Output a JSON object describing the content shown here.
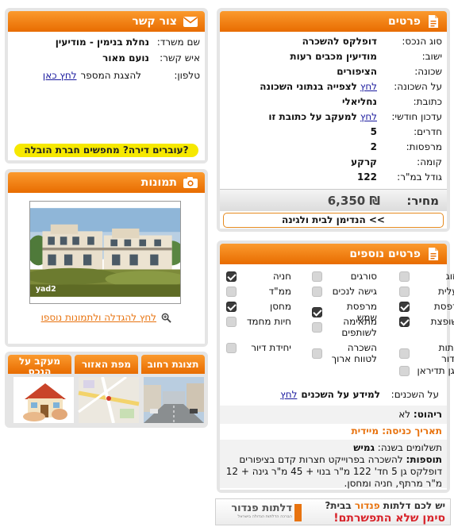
{
  "details": {
    "title": "פרטים",
    "rows": [
      {
        "label": "סוג הנכס:",
        "value": "דופלקס להשכרה"
      },
      {
        "label": "ישוב:",
        "value": "מודיעין מכבים רעות"
      },
      {
        "label": "שכונה:",
        "value": "הציפורים"
      },
      {
        "label": "על השכונה:",
        "value": "לצפייה בנתוני השכונה",
        "link": "לחץ"
      },
      {
        "label": "כתובת:",
        "value": "נחליאלי"
      },
      {
        "label": "עדכון חודשי:",
        "value": "למעקב על כתובת זו",
        "link": "לחץ"
      },
      {
        "label": "חדרים:",
        "value": "5"
      },
      {
        "label": "מרפסות:",
        "value": "2"
      },
      {
        "label": "קומה:",
        "value": "קרקע"
      },
      {
        "label": "גודל במ\"ר:",
        "value": "122"
      }
    ],
    "price_label": "מחיר:",
    "price_value": "₪ 6,350",
    "price_button": "הנדימן לבית ולגינה <<"
  },
  "contact": {
    "title": "צור קשר",
    "rows": [
      {
        "label": "שם משרד:",
        "value": "נחלת בנימין - מודיעין"
      },
      {
        "label": "איש קשר:",
        "value": "נועם מאור"
      }
    ],
    "phone_label": "טלפון:",
    "phone_text": "להצגת המספר",
    "phone_link": "לחץ כאן",
    "moving_banner": "עוברים דירה? מחפשים חברת הובלה?"
  },
  "photos": {
    "title": "תמונות",
    "watermark": "yad2",
    "enlarge_link": "לחץ להגדלה ולתמונות נוספו"
  },
  "tabs": [
    {
      "label": "תצוגת רחוב"
    },
    {
      "label": "מפת האזור"
    },
    {
      "label": "מעקב על הנכס"
    }
  ],
  "extras": {
    "title": "פרטים נוספים",
    "features": [
      {
        "label": "מיזוג",
        "checked": false
      },
      {
        "label": "סורגים",
        "checked": false
      },
      {
        "label": "חניה",
        "checked": true
      },
      {
        "label": "מעלית",
        "checked": false
      },
      {
        "label": "גישה לנכים",
        "checked": false
      },
      {
        "label": "ממ\"ד",
        "checked": false
      },
      {
        "label": "מרפסת",
        "checked": true
      },
      {
        "label": "מרפסת שמש",
        "checked": true
      },
      {
        "label": "מחסן",
        "checked": true
      },
      {
        "label": "משופצת",
        "checked": true
      },
      {
        "label": "מתאימה לשותפים",
        "checked": false
      },
      {
        "label": "חיות מחמד",
        "checked": false
      },
      {
        "label": "דלתות פנדור",
        "checked": false
      },
      {
        "label": "השכרה לטווח ארוך",
        "checked": false
      },
      {
        "label": "יחידת דיור",
        "checked": false
      },
      {
        "label": "מזגן תדיראן",
        "checked": false
      }
    ],
    "neighbors_label": "על השכנים:",
    "neighbors_text": "למידע על השכנים",
    "neighbors_link": "לחץ",
    "furniture_label": "ריהוט:",
    "furniture_value": "לא",
    "entry_label": "תאריך כניסה:",
    "entry_value": "מיידית",
    "payments_label": "תשלומים בשנה:",
    "payments_value": "גמיש",
    "notes_label": "תוספות:",
    "notes_text": "להשכרה בפרוייקט חצרות קדם בציפורים דופלקס גן 5 חד' 122 מ\"ר בנוי + 45 מ\"ר גינה + 12 מ\"ר מרתף, חניה ומחסן."
  },
  "ad": {
    "line1_a": "יש לכם דלתות ",
    "line1_brand": "פנדור",
    "line1_b": " בבית?",
    "line2": "סימן שלא התפשרתם!",
    "logo": "דלתות פנדור",
    "logo_sub": "הברכה הדלתות הגדולה בישראל"
  },
  "colors": {
    "accent": "#f07d10",
    "link": "#1a1a9e",
    "banner_yellow": "#f6e800"
  }
}
